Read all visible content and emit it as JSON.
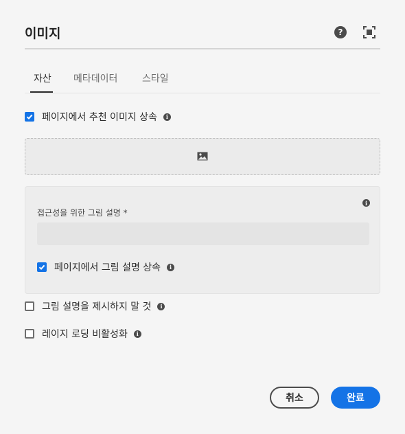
{
  "dialog": {
    "title": "이미지",
    "help_icon": "help-icon",
    "fullscreen_icon": "fullscreen-icon"
  },
  "tabs": [
    {
      "label": "자산",
      "active": true
    },
    {
      "label": "메타데이터",
      "active": false
    },
    {
      "label": "스타일",
      "active": false
    }
  ],
  "options": {
    "inherit_featured_image": {
      "label": "페이지에서 추천 이미지 상속",
      "checked": true
    },
    "alt_text_label": "접근성을 위한 그림 설명 *",
    "alt_text_value": "",
    "inherit_alt_text": {
      "label": "페이지에서 그림 설명 상속",
      "checked": true
    },
    "no_alt_text": {
      "label": "그림 설명을 제시하지 말 것",
      "checked": false
    },
    "disable_lazy_loading": {
      "label": "레이지 로딩 비활성화",
      "checked": false
    }
  },
  "dropzone": {
    "icon": "image-icon"
  },
  "buttons": {
    "cancel": "취소",
    "done": "완료"
  },
  "colors": {
    "accent": "#1473e6",
    "background": "#f5f5f5"
  }
}
